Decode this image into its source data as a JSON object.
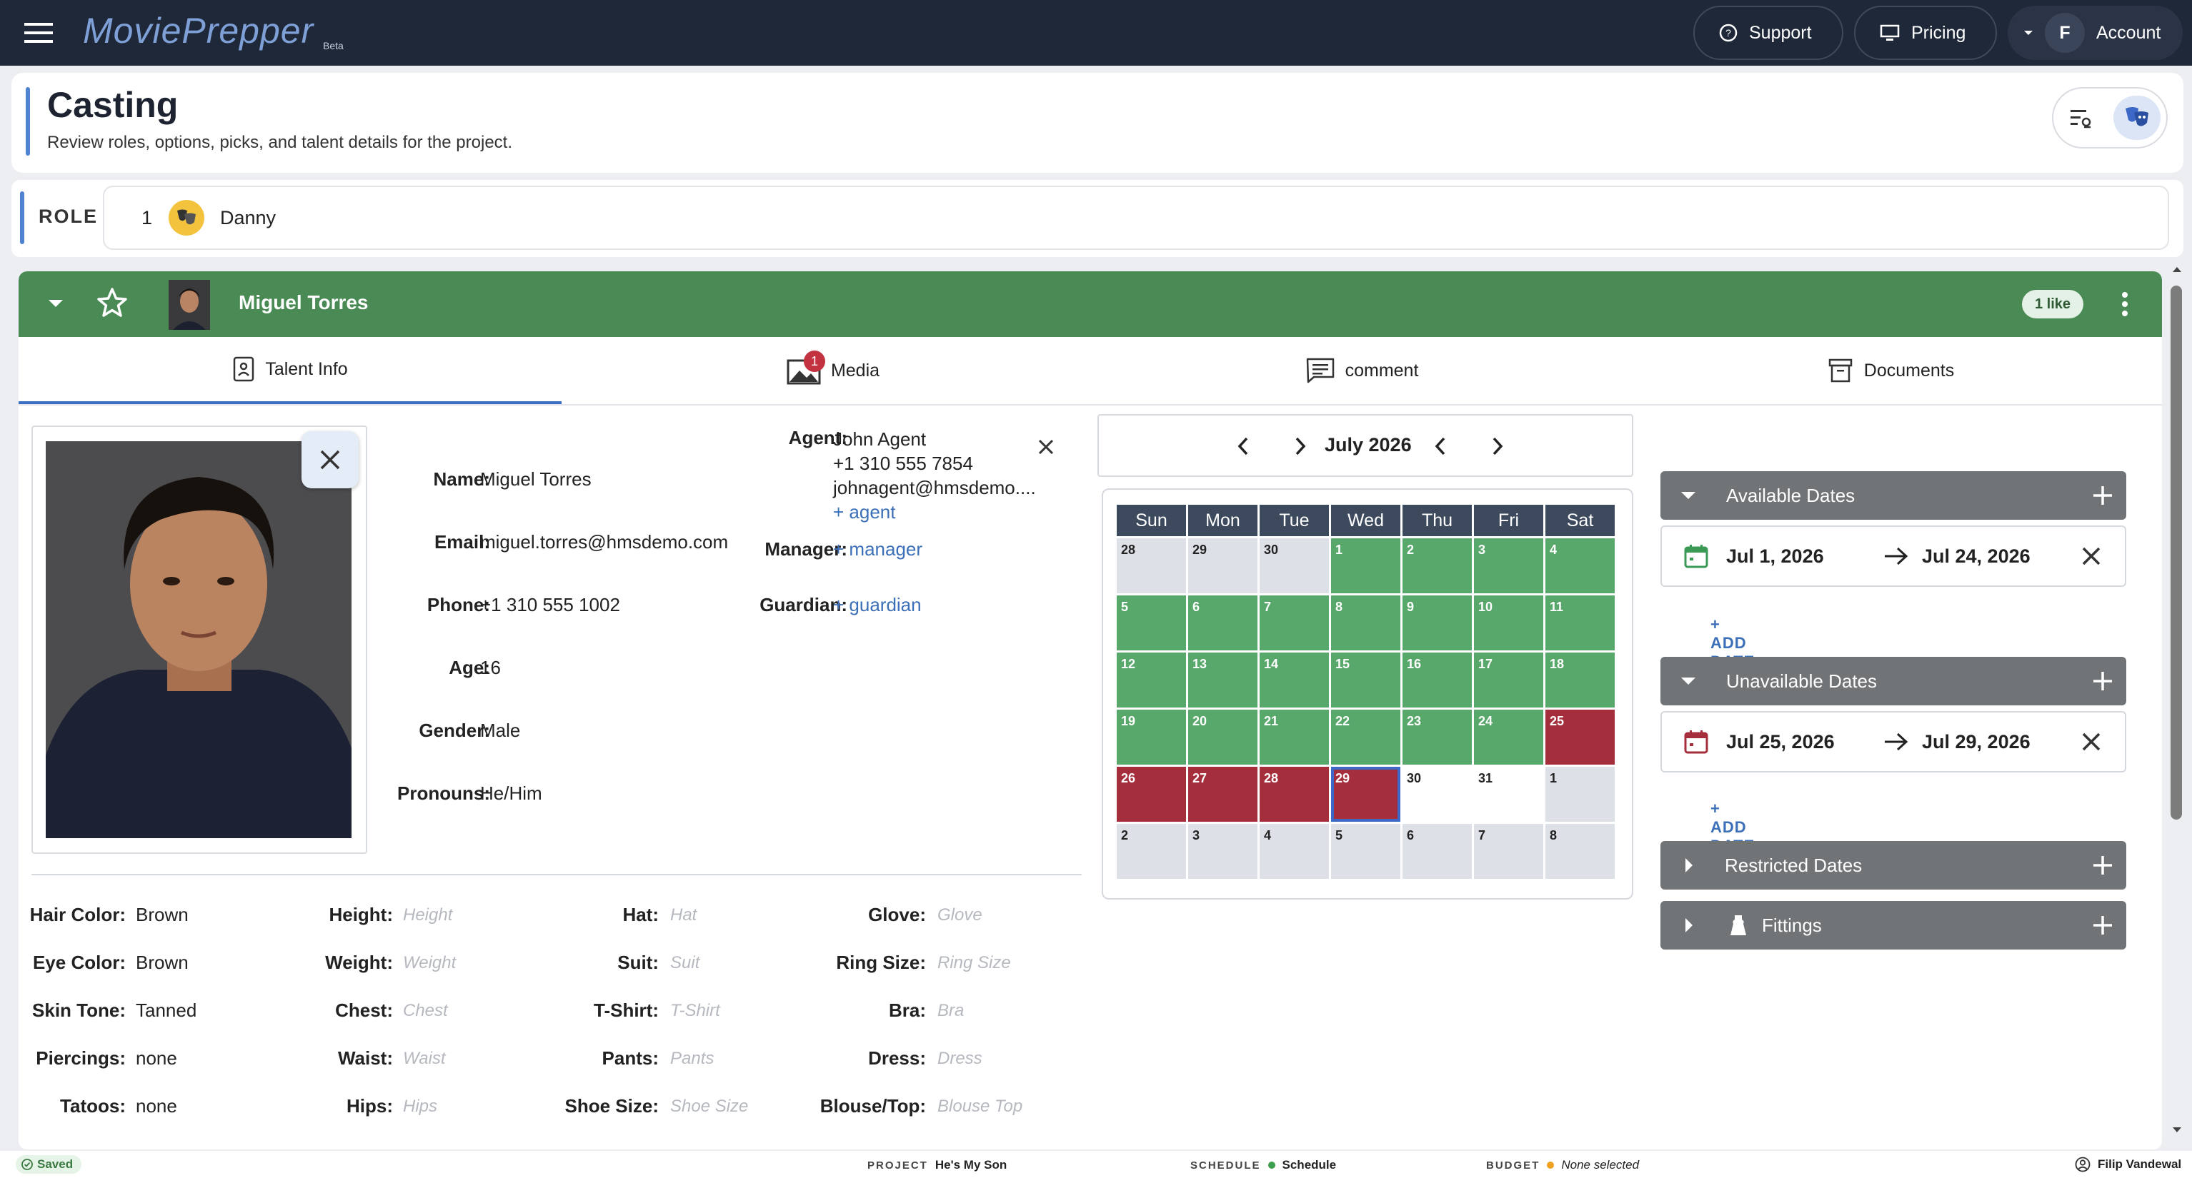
{
  "app": {
    "logo": "MoviePrepper",
    "logo_badge": "Beta"
  },
  "topbar": {
    "support_label": "Support",
    "pricing_label": "Pricing",
    "account_initial": "F",
    "account_label": "Account"
  },
  "header": {
    "title": "Casting",
    "subtitle": "Review roles, options, picks, and talent details for the project."
  },
  "role": {
    "label": "ROLE",
    "number": "1",
    "name": "Danny"
  },
  "talent": {
    "name": "Miguel Torres",
    "likes": "1 like"
  },
  "tabs": [
    {
      "label": "Talent Info",
      "active": true
    },
    {
      "label": "Media",
      "badge": "1"
    },
    {
      "label": "comment"
    },
    {
      "label": "Documents"
    }
  ],
  "info": {
    "name_label": "Name:",
    "name": "Miguel Torres",
    "email_label": "Email:",
    "email": "miguel.torres@hmsdemo.com",
    "phone_label": "Phone:",
    "phone": "+1 310 555 1002",
    "age_label": "Age:",
    "age": "16",
    "gender_label": "Gender:",
    "gender": "Male",
    "pronouns_label": "Pronouns:",
    "pronouns": "He/Him"
  },
  "contacts": {
    "agent_label": "Agent:",
    "agent_name": "John Agent",
    "agent_phone": "+1 310 555 7854",
    "agent_email": "johnagent@hmsdemo....",
    "add_agent": "+ agent",
    "manager_label": "Manager:",
    "add_manager": "+ manager",
    "guardian_label": "Guardian:",
    "add_guardian": "+ guardian"
  },
  "attributes": {
    "col1": [
      {
        "label": "Hair Color:",
        "value": "Brown"
      },
      {
        "label": "Eye Color:",
        "value": "Brown"
      },
      {
        "label": "Skin Tone:",
        "value": "Tanned"
      },
      {
        "label": "Piercings:",
        "value": "none"
      },
      {
        "label": "Tatoos:",
        "value": "none"
      }
    ],
    "col2": [
      {
        "label": "Height:",
        "placeholder": "Height"
      },
      {
        "label": "Weight:",
        "placeholder": "Weight"
      },
      {
        "label": "Chest:",
        "placeholder": "Chest"
      },
      {
        "label": "Waist:",
        "placeholder": "Waist"
      },
      {
        "label": "Hips:",
        "placeholder": "Hips"
      }
    ],
    "col3": [
      {
        "label": "Hat:",
        "placeholder": "Hat"
      },
      {
        "label": "Suit:",
        "placeholder": "Suit"
      },
      {
        "label": "T-Shirt:",
        "placeholder": "T-Shirt"
      },
      {
        "label": "Pants:",
        "placeholder": "Pants"
      },
      {
        "label": "Shoe Size:",
        "placeholder": "Shoe Size"
      }
    ],
    "col4": [
      {
        "label": "Glove:",
        "placeholder": "Glove"
      },
      {
        "label": "Ring Size:",
        "placeholder": "Ring Size"
      },
      {
        "label": "Bra:",
        "placeholder": "Bra"
      },
      {
        "label": "Dress:",
        "placeholder": "Dress"
      },
      {
        "label": "Blouse/Top:",
        "placeholder": "Blouse Top"
      }
    ]
  },
  "calendar": {
    "month_label": "July 2026",
    "weekdays": [
      "Sun",
      "Mon",
      "Tue",
      "Wed",
      "Thu",
      "Fri",
      "Sat"
    ],
    "weeks": [
      [
        {
          "d": "28",
          "s": "gr"
        },
        {
          "d": "29",
          "s": "gr"
        },
        {
          "d": "30",
          "s": "gr"
        },
        {
          "d": "1",
          "s": "g"
        },
        {
          "d": "2",
          "s": "g"
        },
        {
          "d": "3",
          "s": "g"
        },
        {
          "d": "4",
          "s": "g"
        }
      ],
      [
        {
          "d": "5",
          "s": "g"
        },
        {
          "d": "6",
          "s": "g"
        },
        {
          "d": "7",
          "s": "g"
        },
        {
          "d": "8",
          "s": "g"
        },
        {
          "d": "9",
          "s": "g"
        },
        {
          "d": "10",
          "s": "g"
        },
        {
          "d": "11",
          "s": "g"
        }
      ],
      [
        {
          "d": "12",
          "s": "g"
        },
        {
          "d": "13",
          "s": "g"
        },
        {
          "d": "14",
          "s": "g"
        },
        {
          "d": "15",
          "s": "g"
        },
        {
          "d": "16",
          "s": "g"
        },
        {
          "d": "17",
          "s": "g"
        },
        {
          "d": "18",
          "s": "g"
        }
      ],
      [
        {
          "d": "19",
          "s": "g"
        },
        {
          "d": "20",
          "s": "g"
        },
        {
          "d": "21",
          "s": "g"
        },
        {
          "d": "22",
          "s": "g"
        },
        {
          "d": "23",
          "s": "g"
        },
        {
          "d": "24",
          "s": "g"
        },
        {
          "d": "25",
          "s": "r"
        }
      ],
      [
        {
          "d": "26",
          "s": "r"
        },
        {
          "d": "27",
          "s": "r"
        },
        {
          "d": "28",
          "s": "r"
        },
        {
          "d": "29",
          "s": "r sel"
        },
        {
          "d": "30",
          "s": "w"
        },
        {
          "d": "31",
          "s": "w"
        },
        {
          "d": "1",
          "s": "gr"
        }
      ],
      [
        {
          "d": "2",
          "s": "gr"
        },
        {
          "d": "3",
          "s": "gr"
        },
        {
          "d": "4",
          "s": "gr"
        },
        {
          "d": "5",
          "s": "gr"
        },
        {
          "d": "6",
          "s": "gr"
        },
        {
          "d": "7",
          "s": "gr"
        },
        {
          "d": "8",
          "s": "gr"
        }
      ]
    ],
    "colors": {
      "available": "#58a86b",
      "unavailable": "#a42e3c",
      "outside_month": "#dde0e6",
      "selected_outline": "#3d68c8"
    }
  },
  "dates": {
    "available_title": "Available Dates",
    "available_from": "Jul 1, 2026",
    "available_to": "Jul 24, 2026",
    "add_date_label": "+ ADD DATE",
    "unavailable_title": "Unavailable Dates",
    "unavailable_from": "Jul 25, 2026",
    "unavailable_to": "Jul 29, 2026",
    "restricted_title": "Restricted Dates",
    "fittings_title": "Fittings"
  },
  "footer": {
    "saved": "Saved",
    "project_label": "PROJECT",
    "project": "He's My Son",
    "schedule_label": "SCHEDULE",
    "schedule": "Schedule",
    "budget_label": "BUDGET",
    "budget": "None selected",
    "user": "Filip Vandewal"
  }
}
